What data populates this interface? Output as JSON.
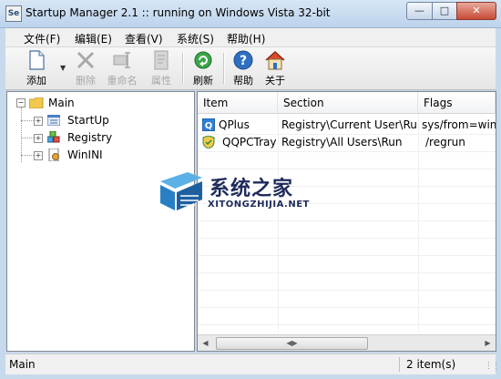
{
  "window": {
    "icon_text": "Se",
    "title": "Startup Manager 2.1 :: running on Windows Vista 32-bit"
  },
  "menu": {
    "items": [
      {
        "label": "文件(F)"
      },
      {
        "label": "编辑(E)"
      },
      {
        "label": "查看(V)"
      },
      {
        "label": "系统(S)"
      },
      {
        "label": "帮助(H)"
      }
    ]
  },
  "toolbar": {
    "add_label": "添加",
    "delete_label": "删除",
    "rename_label": "重命名",
    "properties_label": "属性",
    "refresh_label": "刷新",
    "help_label": "帮助",
    "about_label": "关于"
  },
  "tree": {
    "root": "Main",
    "children": [
      "StartUp",
      "Registry",
      "WinINI"
    ]
  },
  "list": {
    "columns": [
      "Item",
      "Section",
      "Flags"
    ],
    "rows": [
      {
        "item": "QPlus",
        "section": "Registry\\Current User\\Run",
        "flags": "sys/from=win..."
      },
      {
        "item": "QQPCTray",
        "section": "Registry\\All Users\\Run",
        "flags": "/regrun"
      }
    ]
  },
  "watermark": {
    "cn": "系统之家",
    "en": "XITONGZHIJIA.NET"
  },
  "status": {
    "left": "Main",
    "right": "2 item(s)"
  },
  "colors": {
    "title_bg": "#c7d9ec",
    "close_red": "#c74a36",
    "folder_yellow": "#f2c94c"
  }
}
